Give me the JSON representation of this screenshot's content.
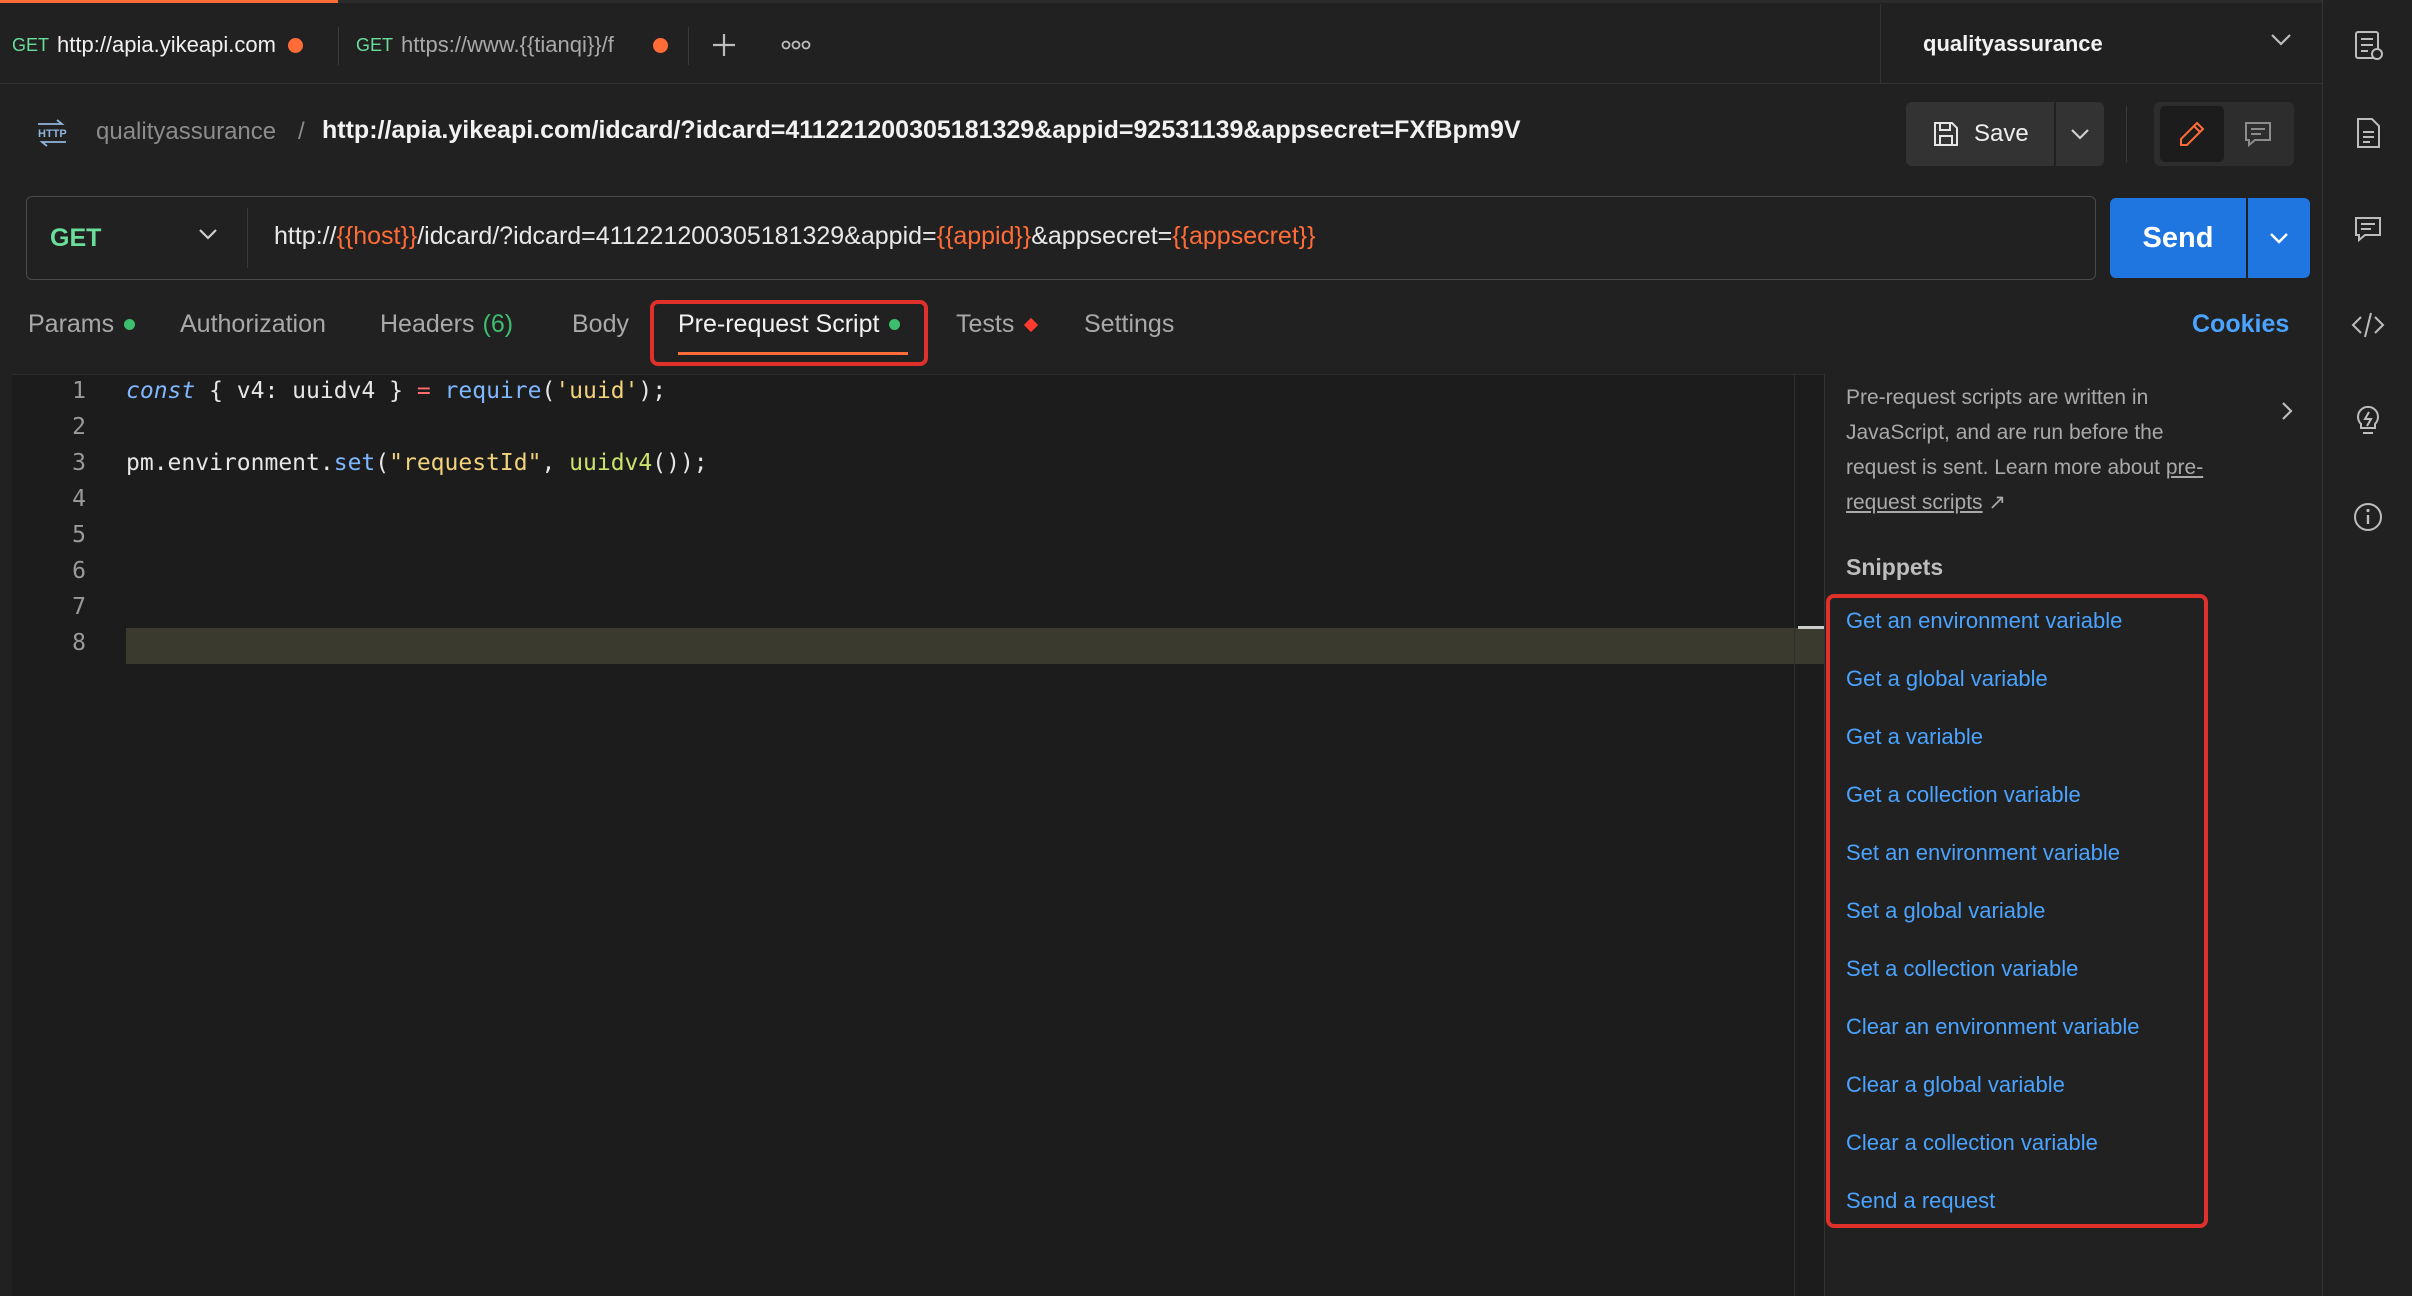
{
  "tabs": [
    {
      "method": "GET",
      "url": "http://apia.yikeapi.com"
    },
    {
      "method": "GET",
      "url": "https://www.{{tianqi}}/f"
    }
  ],
  "workspace": "qualityassurance",
  "breadcrumb": {
    "workspace": "qualityassurance",
    "separator": "/",
    "request_name": "http://apia.yikeapi.com/idcard/?idcard=411221200305181329&appid=92531139&appsecret=FXfBpm9V"
  },
  "toolbar": {
    "save_label": "Save"
  },
  "request": {
    "method": "GET",
    "url_parts": {
      "p1": "http://",
      "v1": "{{host}}",
      "p2": "/idcard/?idcard=411221200305181329&appid=",
      "v2": "{{appid}}",
      "p3": "&appsecret=",
      "v3": "{{appsecret}}"
    },
    "send_label": "Send"
  },
  "req_tabs": {
    "params": "Params",
    "authorization": "Authorization",
    "headers": "Headers",
    "headers_count": "(6)",
    "body": "Body",
    "prerequest": "Pre-request Script",
    "tests": "Tests",
    "settings": "Settings",
    "cookies": "Cookies"
  },
  "editor": {
    "line_numbers": [
      "1",
      "2",
      "3",
      "4",
      "5",
      "6",
      "7",
      "8"
    ],
    "line1": {
      "kw": "const",
      "a": " { v4: uuidv4 } ",
      "op": "=",
      "sp": " ",
      "fn": "require",
      "b": "(",
      "str": "'uuid'",
      "c": ");"
    },
    "line3": {
      "a": "pm.environment.",
      "fn": "set",
      "b": "(",
      "str": "\"requestId\"",
      "c": ", ",
      "fn2": "uuidv4",
      "d": "());"
    }
  },
  "side_panel": {
    "desc": "Pre-request scripts are written in JavaScript, and are run before the request is sent. Learn more about ",
    "link": "pre-request scripts",
    "link_arrow": "↗",
    "snippets_title": "Snippets",
    "snippets": [
      "Get an environment variable",
      "Get a global variable",
      "Get a variable",
      "Get a collection variable",
      "Set an environment variable",
      "Set a global variable",
      "Set a collection variable",
      "Clear an environment variable",
      "Clear a global variable",
      "Clear a collection variable",
      "Send a request"
    ]
  },
  "colors": {
    "accent": "#ff6c37",
    "send": "#1f76e0",
    "link": "#4aa3ff",
    "method_get": "#6bdd9a",
    "highlight_box": "#e0302a"
  },
  "icons": [
    "plus-icon",
    "more-icon",
    "chevron-down-icon",
    "http-icon",
    "save-icon",
    "pencil-icon",
    "comment-icon",
    "chevron-right-icon",
    "environment-icon",
    "documentation-icon",
    "comments-icon",
    "code-icon",
    "lightbulb-icon",
    "info-icon"
  ]
}
